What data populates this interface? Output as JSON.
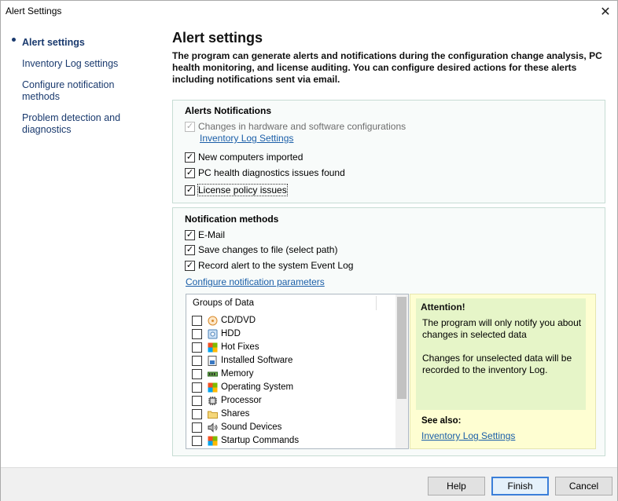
{
  "window": {
    "title": "Alert Settings",
    "close_glyph": "✕"
  },
  "sidebar": {
    "items": [
      {
        "label": "Alert settings",
        "active": true
      },
      {
        "label": "Inventory Log settings",
        "active": false
      },
      {
        "label": "Configure notification methods",
        "active": false
      },
      {
        "label": "Problem detection and diagnostics",
        "active": false
      }
    ]
  },
  "main": {
    "title": "Alert settings",
    "description": "The program can generate alerts and notifications during the configuration change analysis, PC health monitoring, and license auditing. You can configure desired actions for these alerts including notifications sent via email."
  },
  "alerts_panel": {
    "title": "Alerts Notifications",
    "items": [
      {
        "label": "Changes in hardware and software configurations",
        "checked": true,
        "disabled": true
      },
      {
        "label": "New computers imported",
        "checked": true,
        "disabled": false
      },
      {
        "label": "PC health diagnostics issues found",
        "checked": true,
        "disabled": false
      },
      {
        "label": "License policy issues",
        "checked": true,
        "disabled": false
      }
    ],
    "inventory_link": "Inventory Log Settings"
  },
  "notification_panel": {
    "title": "Notification methods",
    "items": [
      {
        "label": "E-Mail",
        "checked": true
      },
      {
        "label": "Save changes to file (select path)",
        "checked": true
      },
      {
        "label": "Record alert to the system Event Log",
        "checked": true
      }
    ],
    "configure_link": "Configure notification parameters"
  },
  "groups": {
    "header": "Groups of Data",
    "items": [
      {
        "label": "CD/DVD",
        "icon": "cd-dvd-icon",
        "checked": false
      },
      {
        "label": "HDD",
        "icon": "hdd-icon",
        "checked": false
      },
      {
        "label": "Hot Fixes",
        "icon": "hot-fixes-icon",
        "checked": false
      },
      {
        "label": "Installed Software",
        "icon": "installed-software-icon",
        "checked": false
      },
      {
        "label": "Memory",
        "icon": "memory-icon",
        "checked": false
      },
      {
        "label": "Operating System",
        "icon": "operating-system-icon",
        "checked": false
      },
      {
        "label": "Processor",
        "icon": "processor-icon",
        "checked": false
      },
      {
        "label": "Shares",
        "icon": "shares-icon",
        "checked": false
      },
      {
        "label": "Sound Devices",
        "icon": "sound-devices-icon",
        "checked": false
      },
      {
        "label": "Startup Commands",
        "icon": "startup-commands-icon",
        "checked": false
      }
    ]
  },
  "attention": {
    "title": "Attention!",
    "text1": "The program will only notify you about changes in selected data",
    "text2": "Changes for unselected data will be recorded to the inventory Log.",
    "see_also": "See also:",
    "link": "Inventory Log Settings"
  },
  "footer": {
    "help": "Help",
    "finish": "Finish",
    "cancel": "Cancel"
  },
  "colors": {
    "accent": "#1a3a6e",
    "link": "#1a5ea8",
    "panel_bg": "#f8fbfa",
    "attention_bg": "#e6f5c8"
  }
}
